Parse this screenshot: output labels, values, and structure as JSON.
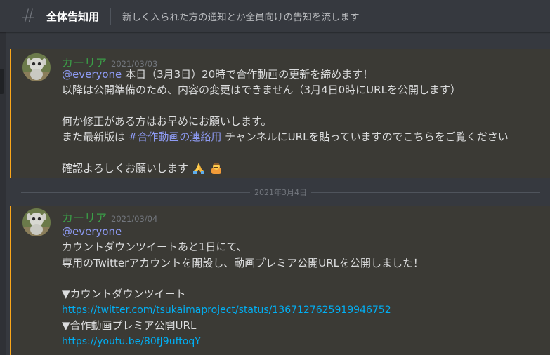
{
  "header": {
    "hash_icon": "hash-icon",
    "channel_name": "全体告知用",
    "topic": "新しく入られた方の通知とか全員向けの告知を流します"
  },
  "date_separator": "2021年3月4日",
  "messages": [
    {
      "author": "カーリア",
      "timestamp": "2021/03/03",
      "mention": "@everyone",
      "line1_rest": " 本日（3月3日）20時で合作動画の更新を締めます！",
      "line2": "以降は公開準備のため、内容の変更はできません（3月4日0時にURLを公開します）",
      "line3": "何か修正がある方はお早めにお願いします。",
      "line4_pre": "また最新版は ",
      "channel_link": "#合作動画の連絡用",
      "line4_post": " チャンネルにURLを貼っていますのでこちらをご覧ください",
      "line5": "確認よろしくお願いします ",
      "emojis": [
        "folded-hands-emoji",
        "bowing-person-emoji"
      ]
    },
    {
      "author": "カーリア",
      "timestamp": "2021/03/04",
      "mention": "@everyone",
      "line1": "カウントダウンツイートあと1日にて、",
      "line2": "専用のTwitterアカウントを開設し、動画プレミア公開URLを公開しました！",
      "line3": "▼カウントダウンツイート",
      "link1": "https://twitter.com/tsukaimaproject/status/1367127625919946752",
      "line4": "▼合作動画プレミア公開URL",
      "link2": "https://youtu.be/80fJ9uftoqY"
    }
  ],
  "colors": {
    "background": "#36393f",
    "highlight": "#3b3a35",
    "highlight_border": "#faa61a",
    "author": "#3b9f48",
    "mention": "#8e9bf4",
    "link": "#00aff4"
  }
}
